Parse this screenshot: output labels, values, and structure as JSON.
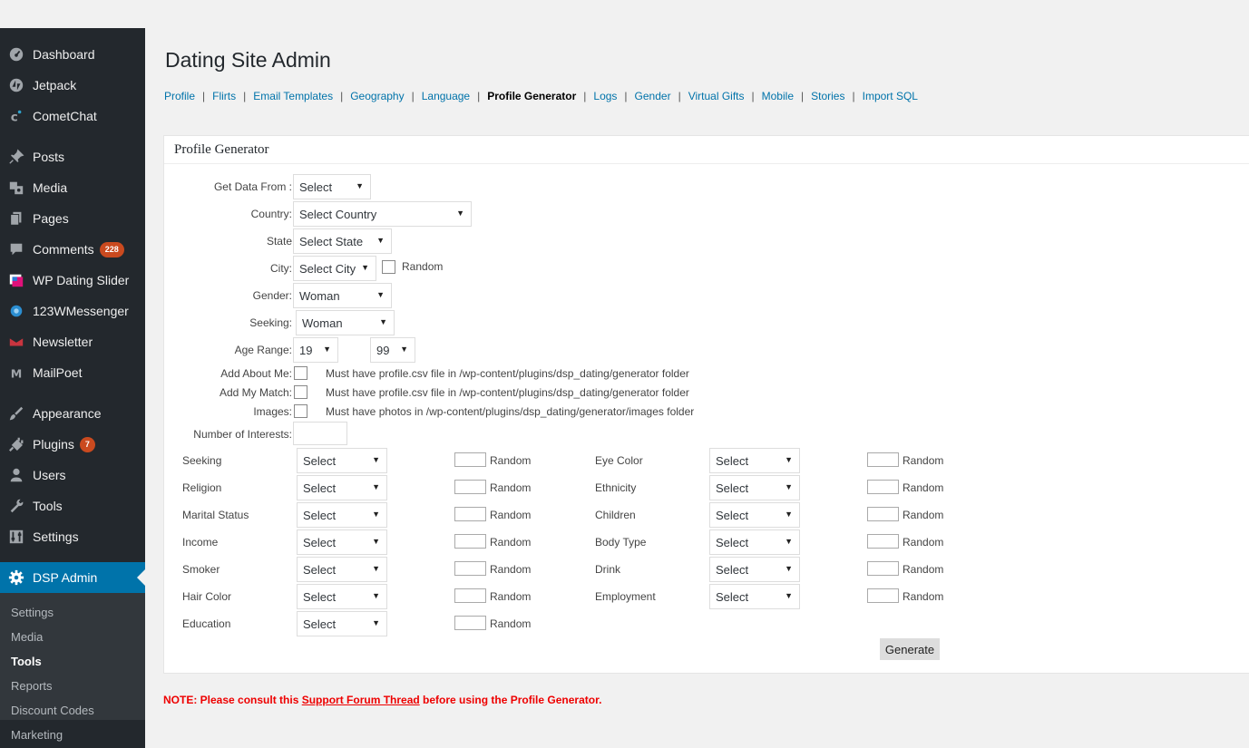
{
  "sidebar": {
    "items": [
      {
        "label": "Dashboard",
        "icon": "dashboard-icon"
      },
      {
        "label": "Jetpack",
        "icon": "jetpack-icon"
      },
      {
        "label": "CometChat",
        "icon": "cometchat-icon"
      },
      {
        "label": "Posts",
        "icon": "pin-icon"
      },
      {
        "label": "Media",
        "icon": "media-icon"
      },
      {
        "label": "Pages",
        "icon": "pages-icon"
      },
      {
        "label": "Comments",
        "icon": "comment-icon",
        "badge": "228"
      },
      {
        "label": "WP Dating Slider",
        "icon": "slider-icon"
      },
      {
        "label": "123WMessenger",
        "icon": "messenger-icon"
      },
      {
        "label": "Newsletter",
        "icon": "newsletter-icon"
      },
      {
        "label": "MailPoet",
        "icon": "mailpoet-icon"
      },
      {
        "label": "Appearance",
        "icon": "brush-icon"
      },
      {
        "label": "Plugins",
        "icon": "plugin-icon",
        "badge": "7"
      },
      {
        "label": "Users",
        "icon": "user-icon"
      },
      {
        "label": "Tools",
        "icon": "wrench-icon"
      },
      {
        "label": "Settings",
        "icon": "settings-sliders-icon"
      },
      {
        "label": "DSP Admin",
        "icon": "gear-icon",
        "active": true
      }
    ],
    "submenu": [
      "Settings",
      "Media",
      "Tools",
      "Reports",
      "Discount Codes",
      "Marketing"
    ],
    "submenu_current": "Tools"
  },
  "page": {
    "title": "Dating Site Admin",
    "tabs": [
      "Profile",
      "Flirts",
      "Email Templates",
      "Geography",
      "Language",
      "Profile Generator",
      "Logs",
      "Gender",
      "Virtual Gifts",
      "Mobile",
      "Stories",
      "Import SQL"
    ],
    "current_tab": "Profile Generator"
  },
  "panel": {
    "title": "Profile Generator",
    "get_data_from": {
      "label": "Get Data From :",
      "value": "Select"
    },
    "country": {
      "label": "Country:",
      "value": "Select Country"
    },
    "state": {
      "label": "State",
      "value": "Select State"
    },
    "city": {
      "label": "City:",
      "value": "Select City",
      "random_label": "Random"
    },
    "gender": {
      "label": "Gender:",
      "value": "Woman"
    },
    "seeking": {
      "label": "Seeking:",
      "value": "Woman"
    },
    "age_range": {
      "label": "Age Range:",
      "min": "19",
      "max": "99"
    },
    "add_about_me": {
      "label": "Add About Me:",
      "note": "Must have profile.csv file in /wp-content/plugins/dsp_dating/generator folder"
    },
    "add_my_match": {
      "label": "Add My Match:",
      "note": "Must have profile.csv file in /wp-content/plugins/dsp_dating/generator folder"
    },
    "images": {
      "label": "Images:",
      "note": "Must have photos in /wp-content/plugins/dsp_dating/generator/images folder"
    },
    "num_interests": {
      "label": "Number of Interests:",
      "value": ""
    },
    "random_label": "Random",
    "left_fields": [
      {
        "label": "Seeking",
        "value": "Select"
      },
      {
        "label": "Religion",
        "value": "Select"
      },
      {
        "label": "Marital Status",
        "value": "Select"
      },
      {
        "label": "Income",
        "value": "Select"
      },
      {
        "label": "Smoker",
        "value": "Select"
      },
      {
        "label": "Hair Color",
        "value": "Select"
      },
      {
        "label": "Education",
        "value": "Select"
      }
    ],
    "right_fields": [
      {
        "label": "Eye Color",
        "value": "Select"
      },
      {
        "label": "Ethnicity",
        "value": "Select"
      },
      {
        "label": "Children",
        "value": "Select"
      },
      {
        "label": "Body Type",
        "value": "Select"
      },
      {
        "label": "Drink",
        "value": "Select"
      },
      {
        "label": "Employment",
        "value": "Select"
      }
    ],
    "generate_label": "Generate"
  },
  "note": {
    "prefix": "NOTE: Please consult this ",
    "link": "Support Forum Thread",
    "suffix": " before using the Profile Generator."
  },
  "colors": {
    "sidebar_bg": "#23282d",
    "submenu_bg": "#32373c",
    "active_bg": "#0073aa",
    "badge_bg": "#ca4a1f",
    "link": "#0073aa",
    "note": "#ee0000"
  }
}
